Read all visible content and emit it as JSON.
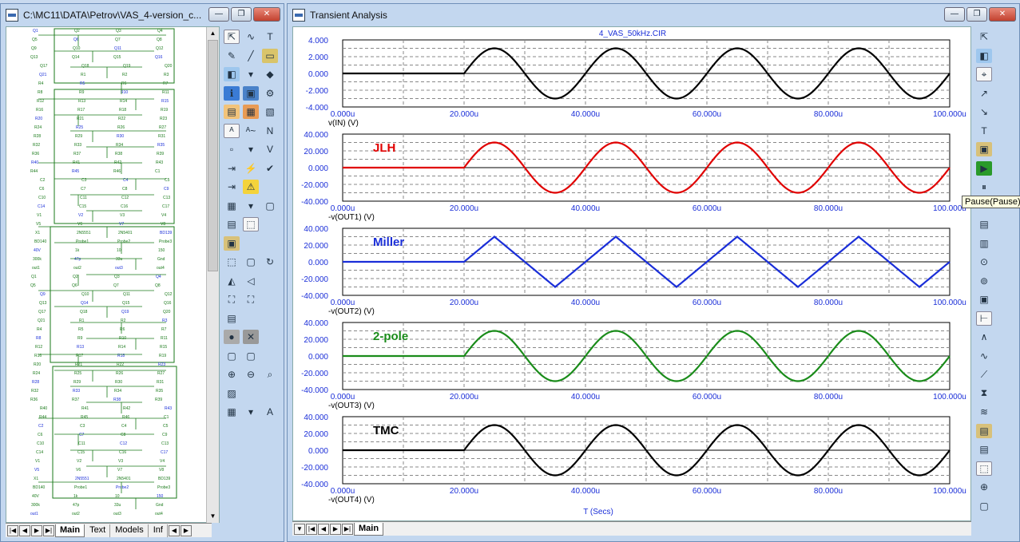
{
  "left_window": {
    "title": "C:\\MC11\\DATA\\Petrov\\VAS_4-version_c...",
    "tabs": [
      "Main",
      "Text",
      "Models",
      "Inf"
    ]
  },
  "right_window": {
    "title": "Transient Analysis",
    "tab": "Main",
    "tooltip": "Pause(Pause)"
  },
  "plots": {
    "file_title": "4_VAS_50kHz.CIR",
    "x_axis_label": "T (Secs)",
    "x_ticks": [
      "0.000u",
      "20.000u",
      "40.000u",
      "60.000u",
      "80.000u",
      "100.000u"
    ],
    "panels": [
      {
        "waveform": "v(IN) (V)",
        "label": "",
        "color": "#000000",
        "y_ticks": [
          "4.000",
          "2.000",
          "0.000",
          "-2.000",
          "-4.000"
        ]
      },
      {
        "waveform": "-v(OUT1) (V)",
        "label": "JLH",
        "color": "#e00000",
        "y_ticks": [
          "40.000",
          "20.000",
          "0.000",
          "-20.000",
          "-40.000"
        ]
      },
      {
        "waveform": "-v(OUT2) (V)",
        "label": "Miller",
        "color": "#1a2ed8",
        "y_ticks": [
          "40.000",
          "20.000",
          "0.000",
          "-20.000",
          "-40.000"
        ]
      },
      {
        "waveform": "-v(OUT3) (V)",
        "label": "2-pole",
        "color": "#1a8c1a",
        "y_ticks": [
          "40.000",
          "20.000",
          "0.000",
          "-20.000",
          "-40.000"
        ]
      },
      {
        "waveform": "-v(OUT4) (V)",
        "label": "TMC",
        "color": "#000000",
        "y_ticks": [
          "40.000",
          "20.000",
          "0.000",
          "-20.000",
          "-40.000"
        ]
      }
    ]
  },
  "chart_data": [
    {
      "type": "line",
      "title": "4_VAS_50kHz.CIR",
      "xlabel": "T (Secs)",
      "ylabel": "v(IN) (V)",
      "xlim": [
        0,
        100
      ],
      "ylim": [
        -4,
        4
      ],
      "grid": true,
      "series": [
        {
          "values": [
            [
              0,
              0
            ],
            [
              20,
              0
            ],
            [
              25,
              3
            ],
            [
              35,
              -3
            ],
            [
              45,
              3
            ],
            [
              55,
              -3
            ],
            [
              65,
              3
            ],
            [
              75,
              -3
            ],
            [
              85,
              3
            ],
            [
              95,
              -3
            ],
            [
              100,
              0
            ]
          ]
        }
      ]
    },
    {
      "type": "line",
      "xlabel": "T (Secs)",
      "ylabel": "-v(OUT1) (V)",
      "xlim": [
        0,
        100
      ],
      "ylim": [
        -40,
        40
      ],
      "grid": true,
      "series": [
        {
          "name": "JLH",
          "values": [
            [
              0,
              0
            ],
            [
              20,
              0
            ],
            [
              25,
              30
            ],
            [
              35,
              -30
            ],
            [
              45,
              30
            ],
            [
              55,
              -30
            ],
            [
              65,
              30
            ],
            [
              75,
              -30
            ],
            [
              85,
              30
            ],
            [
              95,
              -30
            ],
            [
              100,
              0
            ]
          ]
        }
      ]
    },
    {
      "type": "line",
      "xlabel": "T (Secs)",
      "ylabel": "-v(OUT2) (V)",
      "xlim": [
        0,
        100
      ],
      "ylim": [
        -40,
        40
      ],
      "grid": true,
      "series": [
        {
          "name": "Miller",
          "values": [
            [
              0,
              0
            ],
            [
              20,
              0
            ],
            [
              25,
              30
            ],
            [
              35,
              -30
            ],
            [
              45,
              30
            ],
            [
              55,
              -30
            ],
            [
              65,
              30
            ],
            [
              75,
              -30
            ],
            [
              85,
              30
            ],
            [
              95,
              -30
            ],
            [
              100,
              -8
            ]
          ]
        }
      ]
    },
    {
      "type": "line",
      "xlabel": "T (Secs)",
      "ylabel": "-v(OUT3) (V)",
      "xlim": [
        0,
        100
      ],
      "ylim": [
        -40,
        40
      ],
      "grid": true,
      "series": [
        {
          "name": "2-pole",
          "values": [
            [
              0,
              0
            ],
            [
              20,
              0
            ],
            [
              25,
              30
            ],
            [
              35,
              -30
            ],
            [
              45,
              30
            ],
            [
              55,
              -30
            ],
            [
              65,
              30
            ],
            [
              75,
              -30
            ],
            [
              85,
              30
            ],
            [
              95,
              -30
            ],
            [
              100,
              0
            ]
          ]
        }
      ]
    },
    {
      "type": "line",
      "xlabel": "T (Secs)",
      "ylabel": "-v(OUT4) (V)",
      "xlim": [
        0,
        100
      ],
      "ylim": [
        -40,
        40
      ],
      "grid": true,
      "series": [
        {
          "name": "TMC",
          "values": [
            [
              0,
              0
            ],
            [
              20,
              0
            ],
            [
              25,
              30
            ],
            [
              35,
              -30
            ],
            [
              45,
              30
            ],
            [
              55,
              -30
            ],
            [
              65,
              30
            ],
            [
              75,
              -30
            ],
            [
              85,
              30
            ],
            [
              95,
              -30
            ],
            [
              100,
              0
            ]
          ]
        }
      ]
    }
  ],
  "schematic": {
    "labels": [
      "Q1",
      "Q2",
      "Q3",
      "Q4",
      "Q5",
      "Q6",
      "Q7",
      "Q8",
      "Q9",
      "Q10",
      "Q11",
      "Q12",
      "Q13",
      "Q14",
      "Q15",
      "Q16",
      "Q17",
      "Q18",
      "Q19",
      "Q20",
      "Q21",
      "R1",
      "R2",
      "R3",
      "R4",
      "R5",
      "R6",
      "R7",
      "R8",
      "R9",
      "R10",
      "R11",
      "R12",
      "R13",
      "R14",
      "R15",
      "R16",
      "R17",
      "R18",
      "R19",
      "R20",
      "R21",
      "R22",
      "R23",
      "R24",
      "R25",
      "R26",
      "R27",
      "R28",
      "R29",
      "R30",
      "R31",
      "R32",
      "R33",
      "R34",
      "R35",
      "R36",
      "R37",
      "R38",
      "R39",
      "R40",
      "R41",
      "R42",
      "R43",
      "R44",
      "R45",
      "R46",
      "C1",
      "C2",
      "C3",
      "C4",
      "C5",
      "C6",
      "C7",
      "C8",
      "C9",
      "C10",
      "C11",
      "C12",
      "C13",
      "C14",
      "C15",
      "C16",
      "C17",
      "V1",
      "V2",
      "V3",
      "V4",
      "V5",
      "V6",
      "V7",
      "V8",
      "X1",
      "2N5551",
      "2N5401",
      "BD139",
      "BD140",
      "Probe1",
      "Probe2",
      "Probe3",
      "40V",
      "1k",
      "10",
      "150",
      "300k",
      "47p",
      "33u",
      "Gnd",
      "out1",
      "out2",
      "out3",
      "out4"
    ]
  },
  "colors": {
    "jlh": "#e00000",
    "miller": "#1a2ed8",
    "two_pole": "#1a8c1a",
    "tmc": "#000000",
    "grid": "#999999",
    "schematic_wire": "#1a7a1a"
  }
}
